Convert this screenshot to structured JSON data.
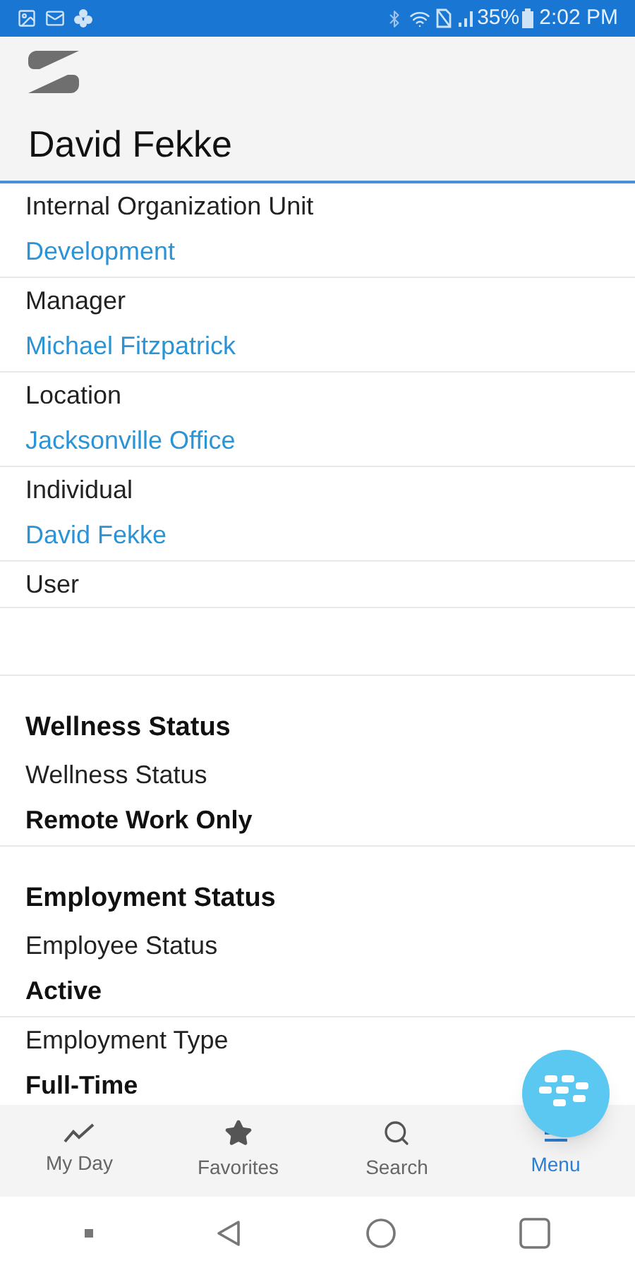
{
  "status_bar": {
    "battery": "35%",
    "time": "2:02 PM"
  },
  "header": {
    "title": "David Fekke"
  },
  "related_fields": [
    {
      "label": "Internal Organization Unit",
      "value": "Development"
    },
    {
      "label": "Manager",
      "value": "Michael Fitzpatrick"
    },
    {
      "label": "Location",
      "value": "Jacksonville Office"
    },
    {
      "label": "Individual",
      "value": "David Fekke"
    },
    {
      "label": "User"
    }
  ],
  "sections": [
    {
      "title": "Wellness Status",
      "fields": [
        {
          "label": "Wellness Status",
          "value": "Remote Work Only"
        }
      ]
    },
    {
      "title": "Employment Status",
      "fields": [
        {
          "label": "Employee Status",
          "value": "Active"
        },
        {
          "label": "Employment Type",
          "value": "Full-Time"
        }
      ]
    }
  ],
  "nav": [
    {
      "kind": "chart",
      "label": "My Day",
      "selected": false
    },
    {
      "kind": "star",
      "label": "Favorites",
      "selected": false
    },
    {
      "kind": "search",
      "label": "Search",
      "selected": false
    },
    {
      "kind": "menu",
      "label": "Menu",
      "selected": true
    }
  ]
}
